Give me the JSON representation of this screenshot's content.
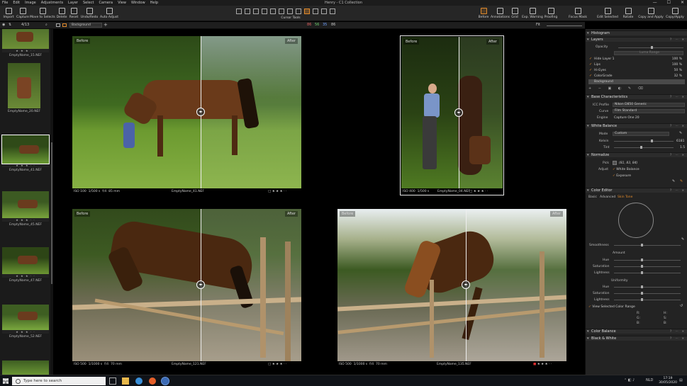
{
  "window": {
    "title": "Henry - C1 Collection",
    "controls": [
      "—",
      "☐",
      "✕"
    ]
  },
  "menu": [
    "File",
    "Edit",
    "Image",
    "Adjustments",
    "Layer",
    "Select",
    "Camera",
    "View",
    "Window",
    "Help"
  ],
  "toolbar": {
    "left": [
      "Import",
      "Capture",
      "Move to Selects",
      "Delete",
      "Reset",
      "Undo/Redo",
      "Auto Adjust"
    ],
    "cursor_tools_label": "Cursor Tools",
    "right": [
      "Before",
      "Annotations",
      "Grid",
      "Exp. Warning",
      "Proofing",
      "Focus Mask",
      "Edit Selected",
      "Rotate",
      "Copy and Apply",
      "Copy/Apply"
    ]
  },
  "toolbar2": {
    "counter": "4/13",
    "layer_select": "Background",
    "values": [
      "86",
      "56",
      "35",
      "86"
    ],
    "fit": "Fit"
  },
  "filmstrip": [
    {
      "name": "EmptyName_15.NEF",
      "stars": "★ ★ ★ · ·"
    },
    {
      "name": "EmptyName_20.NEF",
      "stars": ""
    },
    {
      "name": "EmptyName_41.NEF",
      "stars": "★ ★ ★ · ·"
    },
    {
      "name": "EmptyName_45.NEF",
      "stars": "★ ★ ★ · ·"
    },
    {
      "name": "EmptyName_47.NEF",
      "stars": "★ ★ ★ · ·"
    },
    {
      "name": "EmptyName_52.NEF",
      "stars": "★ ★ ★ · ·"
    }
  ],
  "viewer": {
    "before_label": "Before",
    "after_label": "After",
    "photos": [
      {
        "iso": "ISO 100",
        "shutter": "1/500 s",
        "aperture": "f/4",
        "focal": "85 mm",
        "name": "EmptyName_41.NEF",
        "stars": "★ ★ ★ · ·"
      },
      {
        "iso": "ISO 400",
        "shutter": "1/500 s",
        "aperture": "",
        "focal": "",
        "name": "EmptyName_04.NEF",
        "stars": "★ ★ ★ · ·"
      },
      {
        "iso": "ISO 500",
        "shutter": "1/1000 s",
        "aperture": "f/4",
        "focal": "70 mm",
        "name": "EmptyName_121.NEF",
        "stars": "★ ★ ★ · ·"
      },
      {
        "iso": "ISO 500",
        "shutter": "1/1000 s",
        "aperture": "f/4",
        "focal": "70 mm",
        "name": "EmptyName_135.NEF",
        "stars": "★ ★ ★ · ·"
      }
    ]
  },
  "panel": {
    "histogram": "Histogram",
    "layers": {
      "title": "Layers",
      "opacity_label": "Opacity",
      "luma_range": "Luma Range",
      "items": [
        {
          "name": "Hide Layer 1",
          "pct": "100 %"
        },
        {
          "name": "Lips",
          "pct": "100 %"
        },
        {
          "name": "Hi-Eyes",
          "pct": "50 %"
        },
        {
          "name": "ColorGrade",
          "pct": "32 %"
        },
        {
          "name": "Background",
          "pct": ""
        }
      ]
    },
    "base": {
      "title": "Base Characteristics",
      "icc_label": "ICC Profile",
      "icc_value": "Nikon D850 Generic",
      "curve_label": "Curve",
      "curve_value": "Film Standard",
      "engine_label": "Engine",
      "engine_value": "Capture One 20"
    },
    "wb": {
      "title": "White Balance",
      "mode_label": "Mode",
      "mode_value": "Custom",
      "kelvin_label": "Kelvin",
      "kelvin_value": "6181",
      "tint_label": "Tint",
      "tint_value": "1.5"
    },
    "normalize": {
      "title": "Normalize",
      "pick_label": "Pick",
      "pick_value": "(81, 83, 84)",
      "adjust_label": "Adjust",
      "white_balance": "White Balance",
      "exposure": "Exposure"
    },
    "color_editor": {
      "title": "Color Editor",
      "tabs": [
        "Basic",
        "Advanced",
        "Skin Tone"
      ],
      "smoothness": "Smoothness",
      "amount": "Amount",
      "uniformity": "Uniformity",
      "hue": "Hue",
      "saturation": "Saturation",
      "lightness": "Lightness",
      "view_range": "View Selected Color Range",
      "rgb_left": [
        "R:",
        "G:",
        "B:"
      ],
      "rgb_right": [
        "H:",
        "S:",
        "B:"
      ]
    },
    "color_balance": "Color Balance",
    "bw": "Black & White"
  },
  "taskbar": {
    "search_placeholder": "Type here to search",
    "lang": "NLD",
    "time": "17:19",
    "date": "30/05/2020"
  }
}
